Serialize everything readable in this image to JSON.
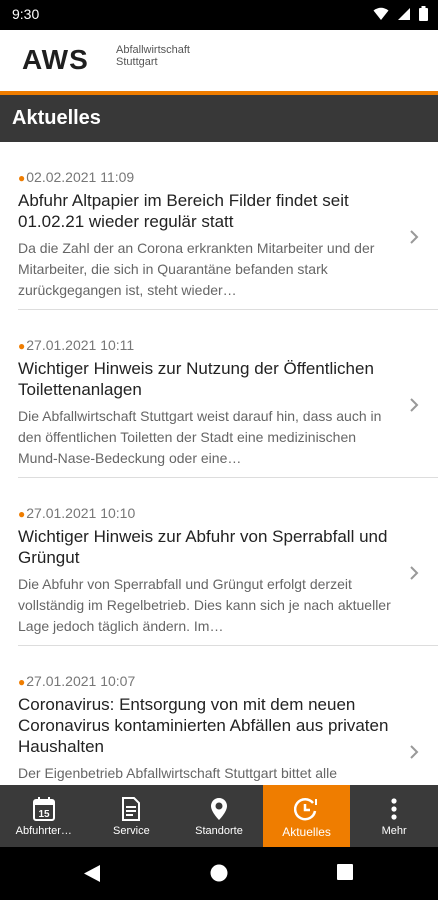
{
  "status": {
    "time": "9:30"
  },
  "header": {
    "logo": "AWS",
    "subtitle_line1": "Abfallwirtschaft",
    "subtitle_line2": "Stuttgart"
  },
  "page": {
    "title": "Aktuelles"
  },
  "news": [
    {
      "date": "02.02.2021 11:09",
      "title": "Abfuhr Altpapier im Bereich Filder findet seit 01.02.21 wieder regulär statt",
      "excerpt": "Da die Zahl der an Corona erkrankten Mitarbeiter und der Mitarbeiter, die sich in Quarantäne befanden stark zurückgegangen ist, steht wieder…"
    },
    {
      "date": "27.01.2021 10:11",
      "title": "Wichtiger Hinweis zur Nutzung der Öffentlichen Toilettenanlagen",
      "excerpt": "Die Abfallwirtschaft Stuttgart weist darauf hin, dass auch in den öffentlichen Toiletten der Stadt eine medizinischen Mund-Nase-Bedeckung oder eine…"
    },
    {
      "date": "27.01.2021 10:10",
      "title": "Wichtiger Hinweis zur Abfuhr von Sperrabfall und Grüngut",
      "excerpt": "Die Abfuhr von Sperrabfall und Grüngut erfolgt derzeit vollständig im Regelbetrieb. Dies kann sich je nach aktueller Lage jedoch täglich ändern. Im…"
    },
    {
      "date": "27.01.2021 10:07",
      "title": "Coronavirus: Entsorgung von mit dem neuen Coronavirus kontaminierten Abfällen aus privaten Haushalten",
      "excerpt": "Der Eigenbetrieb Abfallwirtschaft Stuttgart bittet alle"
    }
  ],
  "nav": [
    {
      "label": "Abfuhrter…",
      "icon": "calendar-icon",
      "calendar_day": "15"
    },
    {
      "label": "Service",
      "icon": "document-icon"
    },
    {
      "label": "Standorte",
      "icon": "location-pin-icon"
    },
    {
      "label": "Aktuelles",
      "icon": "news-clock-icon",
      "active": true
    },
    {
      "label": "Mehr",
      "icon": "more-vertical-icon"
    }
  ],
  "colors": {
    "accent": "#ef7d00",
    "bar": "#383838",
    "nav": "#3a3a3a"
  }
}
